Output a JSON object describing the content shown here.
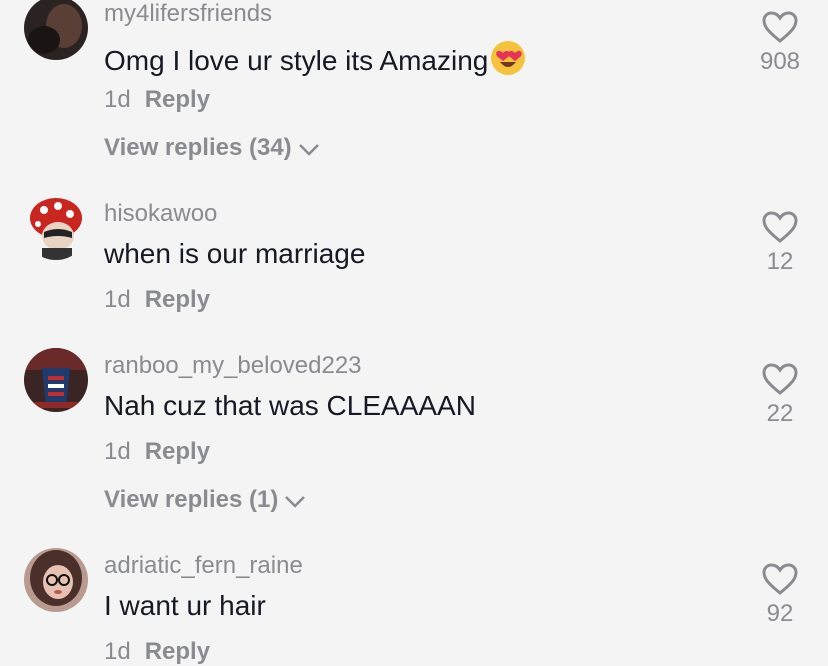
{
  "comments": [
    {
      "username": "my4lifersfriends",
      "text": "Omg I love ur style its Amazing",
      "emoji": "heart-eyes-emoji",
      "time": "1d",
      "reply_label": "Reply",
      "view_replies": "View replies (34)",
      "likes": "908"
    },
    {
      "username": "hisokawoo",
      "text": "when is our marriage",
      "time": "1d",
      "reply_label": "Reply",
      "likes": "12"
    },
    {
      "username": "ranboo_my_beloved223",
      "text": "Nah cuz that was CLEAAAAN",
      "time": "1d",
      "reply_label": "Reply",
      "view_replies": "View replies (1)",
      "likes": "22"
    },
    {
      "username": "adriatic_fern_raine",
      "text": "I want ur hair",
      "time": "1d",
      "reply_label": "Reply",
      "likes": "92"
    }
  ],
  "icons": {
    "like": "heart-outline-icon",
    "expand": "chevron-down-icon"
  },
  "colors": {
    "background": "#f4f4f4",
    "primary_text": "#161823",
    "secondary_text": "#8a8b91"
  }
}
